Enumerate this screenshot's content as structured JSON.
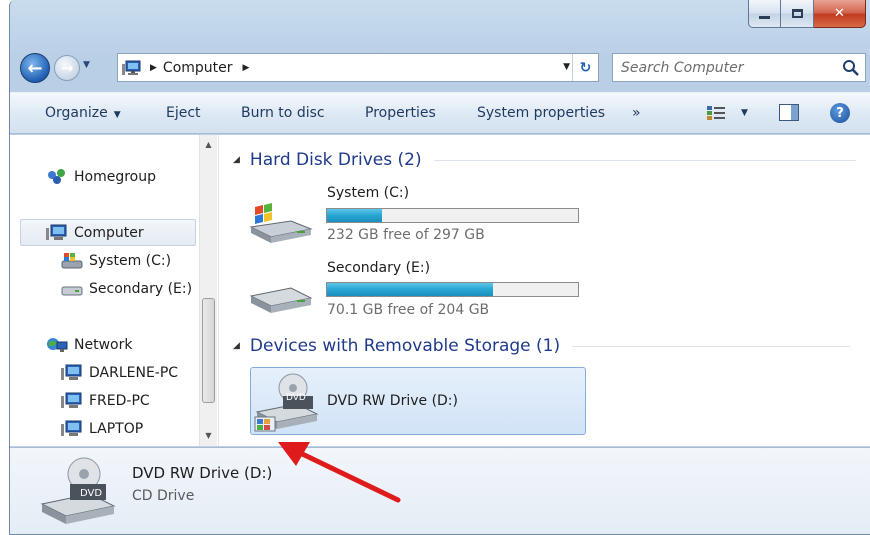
{
  "title_bar": {
    "minimize_icon": "minimize-icon",
    "maximize_icon": "maximize-icon",
    "close_icon": "close-icon"
  },
  "address": {
    "crumb": "Computer",
    "search_placeholder": "Search Computer"
  },
  "toolbar": {
    "organize": "Organize",
    "eject": "Eject",
    "burn": "Burn to disc",
    "properties": "Properties",
    "system_properties": "System properties",
    "more": "»"
  },
  "nav": {
    "homegroup": "Homegroup",
    "computer": "Computer",
    "system": "System (C:)",
    "secondary": "Secondary (E:)",
    "network": "Network",
    "pc1": "DARLENE-PC",
    "pc2": "FRED-PC",
    "pc3": "LAPTOP"
  },
  "groups": {
    "hdd": "Hard Disk Drives (2)",
    "removable": "Devices with Removable Storage (1)"
  },
  "drives": [
    {
      "name": "System (C:)",
      "free": "232 GB free of 297 GB",
      "used_fraction": 0.22
    },
    {
      "name": "Secondary (E:)",
      "free": "70.1 GB free of 204 GB",
      "used_fraction": 0.66
    }
  ],
  "dvd": {
    "name": "DVD RW Drive (D:)",
    "badge": "DVD"
  },
  "details": {
    "name": "DVD RW Drive (D:)",
    "type": "CD Drive",
    "badge": "DVD"
  },
  "colors": {
    "accent": "#1e3a8a",
    "bar_fill": "#27a5d3",
    "annotation_arrow": "#e01b1b"
  }
}
